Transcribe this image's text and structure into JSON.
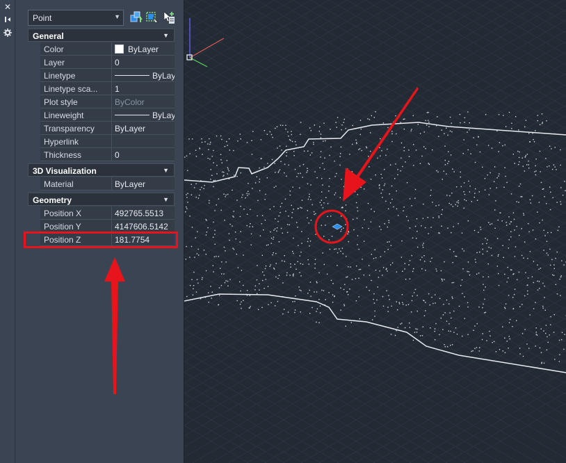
{
  "strip": {
    "icons": [
      "close-icon",
      "auto-hide-icon",
      "properties-settings-icon"
    ]
  },
  "toolbar": {
    "object_type": "Point",
    "buttons": [
      "quick-select-icon",
      "select-objects-icon",
      "toggle-pickadd-icon"
    ]
  },
  "sections": {
    "general": "General",
    "visualization": "3D Visualization",
    "geometry": "Geometry"
  },
  "general": {
    "color": {
      "label": "Color",
      "value": "ByLayer",
      "swatch": "#ffffff"
    },
    "layer": {
      "label": "Layer",
      "value": "0"
    },
    "linetype": {
      "label": "Linetype",
      "value": "ByLayer"
    },
    "linetype_scale": {
      "label": "Linetype sca...",
      "value": "1"
    },
    "plot_style": {
      "label": "Plot style",
      "value": "ByColor"
    },
    "lineweight": {
      "label": "Lineweight",
      "value": "ByLayer"
    },
    "transparency": {
      "label": "Transparency",
      "value": "ByLayer"
    },
    "hyperlink": {
      "label": "Hyperlink",
      "value": ""
    },
    "thickness": {
      "label": "Thickness",
      "value": "0"
    }
  },
  "visualization": {
    "material": {
      "label": "Material",
      "value": "ByLayer"
    }
  },
  "geometry": {
    "position_x": {
      "label": "Position X",
      "value": "492765.5513"
    },
    "position_y": {
      "label": "Position Y",
      "value": "4147606.5142"
    },
    "position_z": {
      "label": "Position Z",
      "value": "181.7754"
    }
  },
  "colors": {
    "annotation": "#e8141b",
    "point_marker": "#2f8fe6",
    "ucs_x": "#e05a5a",
    "ucs_y": "#5bd35b",
    "ucs_z": "#6b6bff"
  }
}
